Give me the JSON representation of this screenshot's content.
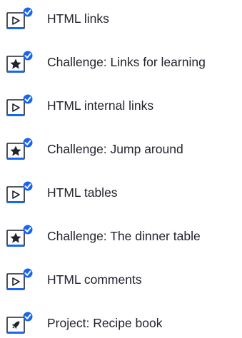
{
  "colors": {
    "text": "#21242c",
    "icon_stroke": "#21242c",
    "underline_accent": "#1865f2",
    "check_badge": "#1865f2"
  },
  "items": [
    {
      "label": "HTML links",
      "kind": "video",
      "icon": "video-play-icon",
      "completed": true
    },
    {
      "label": "Challenge: Links for learning",
      "kind": "challenge",
      "icon": "star-icon",
      "completed": true
    },
    {
      "label": "HTML internal links",
      "kind": "video",
      "icon": "video-play-icon",
      "completed": true
    },
    {
      "label": "Challenge: Jump around",
      "kind": "challenge",
      "icon": "star-icon",
      "completed": true
    },
    {
      "label": "HTML tables",
      "kind": "video",
      "icon": "video-play-icon",
      "completed": true
    },
    {
      "label": "Challenge: The dinner table",
      "kind": "challenge",
      "icon": "star-icon",
      "completed": true
    },
    {
      "label": "HTML comments",
      "kind": "video",
      "icon": "video-play-icon",
      "completed": true
    },
    {
      "label": "Project: Recipe book",
      "kind": "project",
      "icon": "rocket-icon",
      "completed": true
    }
  ]
}
